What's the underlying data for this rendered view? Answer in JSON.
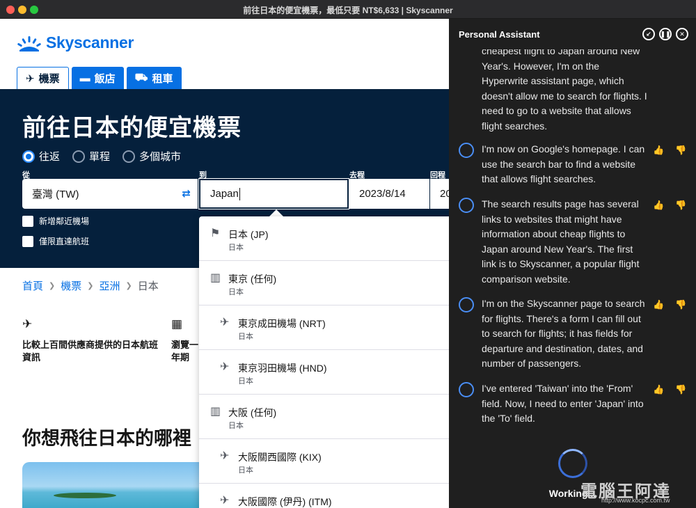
{
  "window": {
    "title": "前往日本的便宜機票，最低只要 NT$6,633 | Skyscanner"
  },
  "site": {
    "logo_text": "Skyscanner",
    "tabs": [
      {
        "icon": "plane-icon",
        "label": "機票"
      },
      {
        "icon": "bed-icon",
        "label": "飯店"
      },
      {
        "icon": "car-icon",
        "label": "租車"
      }
    ],
    "hero_title": "前往日本的便宜機票",
    "trip_types": [
      {
        "label": "往返",
        "selected": true
      },
      {
        "label": "單程",
        "selected": false
      },
      {
        "label": "多個城市",
        "selected": false
      }
    ],
    "fields": {
      "from_label": "從",
      "from_value": "臺灣 (TW)",
      "to_label": "到",
      "to_value": "Japan",
      "depart_label": "去程",
      "depart_value": "2023/8/14",
      "return_label": "回程",
      "return_value": "20"
    },
    "checkboxes": [
      "新增鄰近機場",
      "僅限直達航班"
    ],
    "breadcrumb": [
      "首頁",
      "機票",
      "亞洲",
      "日本"
    ],
    "features": [
      {
        "icon": "plane-icon",
        "text": "比較上百間供應商提供的日本航班資訊"
      },
      {
        "icon": "calendar-icon",
        "text": "瀏覽一年期"
      }
    ],
    "section_title": "你想飛往日本的哪裡"
  },
  "dropdown": [
    {
      "icon": "flag-icon",
      "name": "日本 (JP)",
      "sub": "日本",
      "indent": false
    },
    {
      "icon": "building-icon",
      "name": "東京 (任何)",
      "sub": "日本",
      "indent": false
    },
    {
      "icon": "plane-icon",
      "name": "東京成田機場 (NRT)",
      "sub": "日本",
      "indent": true
    },
    {
      "icon": "plane-icon",
      "name": "東京羽田機場 (HND)",
      "sub": "日本",
      "indent": true
    },
    {
      "icon": "building-icon",
      "name": "大阪 (任何)",
      "sub": "日本",
      "indent": false
    },
    {
      "icon": "plane-icon",
      "name": "大阪關西國際 (KIX)",
      "sub": "日本",
      "indent": true
    },
    {
      "icon": "plane-icon",
      "name": "大阪國際 (伊丹) (ITM)",
      "sub": "",
      "indent": true
    }
  ],
  "assistant": {
    "title": "Personal Assistant",
    "controls": [
      "minimize-icon",
      "pause-icon",
      "close-icon"
    ],
    "messages": [
      {
        "text": "cheapest flight to Japan around New Year's. However, I'm on the Hyperwrite assistant page, which doesn't allow me to search for flights. I need to go to a website that allows flight searches.",
        "partial": true
      },
      {
        "text": "I'm now on Google's homepage. I can use the search bar to find a website that allows flight searches.",
        "partial": false
      },
      {
        "text": "The search results page has several links to websites that might have information about cheap flights to Japan around New Year's. The first link is to Skyscanner, a popular flight comparison website.",
        "partial": false
      },
      {
        "text": "I'm on the Skyscanner page to search for flights. There's a form I can fill out to search for flights; it has fields for departure and destination, dates, and number of passengers.",
        "partial": false
      },
      {
        "text": "I've entered 'Taiwan' into the 'From' field. Now, I need to enter 'Japan' into the 'To' field.",
        "partial": false
      }
    ],
    "status": "Working..."
  },
  "watermark": {
    "text": "電腦王阿達",
    "url": "http://www.kocpc.com.tw"
  },
  "colors": {
    "brand": "#0770e3",
    "hero_bg": "#05203c",
    "panel_bg": "#1f1f1f",
    "accent_ring": "#4a8ef5"
  }
}
